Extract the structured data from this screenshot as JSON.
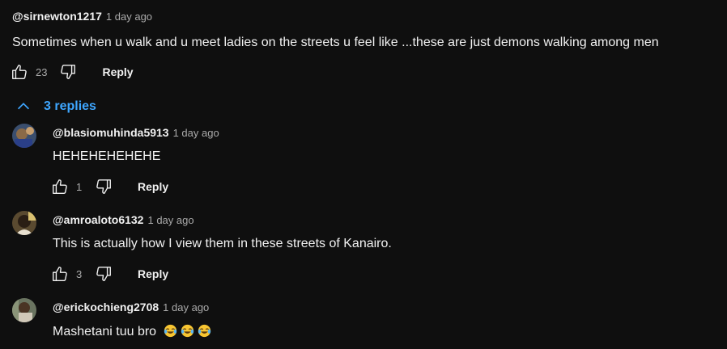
{
  "top_comment": {
    "author": "@sirnewton1217",
    "time": "1 day ago",
    "text": "Sometimes when u walk and u meet ladies on the streets u feel like ...these are just demons walking among men",
    "likes": "23",
    "reply_label": "Reply"
  },
  "replies_toggle": {
    "label": "3 replies",
    "icon": "chevron-up-icon"
  },
  "replies": [
    {
      "author": "@blasiomuhinda5913",
      "time": "1 day ago",
      "text": "HEHEHEHEHEHE",
      "likes": "1",
      "reply_label": "Reply"
    },
    {
      "author": "@amroaloto6132",
      "time": "1 day ago",
      "text": "This is actually how I view them in these streets of Kanairo.",
      "likes": "3",
      "reply_label": "Reply"
    },
    {
      "author": "@erickochieng2708",
      "time": "1 day ago",
      "text": "Mashetani tuu bro",
      "emojis": [
        "😂",
        "😂",
        "😂"
      ]
    }
  ],
  "colors": {
    "background": "#0f0f0f",
    "primary_text": "#f1f1f1",
    "secondary_text": "#aaaaaa",
    "accent": "#3ea6ff"
  },
  "icons": [
    "thumbs-up-icon",
    "thumbs-down-icon",
    "chevron-up-icon",
    "tears-of-joy-emoji"
  ]
}
